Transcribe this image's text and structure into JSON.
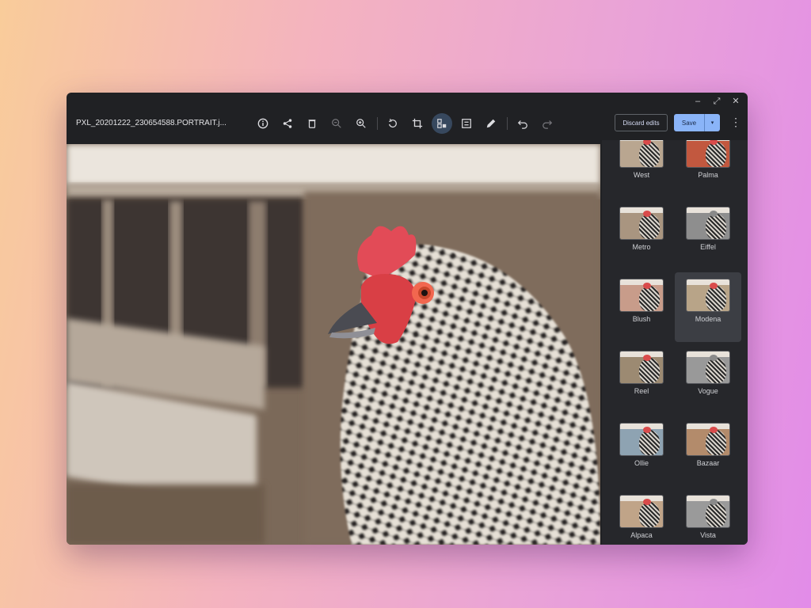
{
  "window": {
    "controls": {
      "minimize": "–",
      "restore": "⤢",
      "close": "✕"
    }
  },
  "toolbar": {
    "filename": "PXL_20201222_230654588.PORTRAIT.j...",
    "tools": [
      {
        "name": "info-icon",
        "glyph": "info"
      },
      {
        "name": "share-icon",
        "glyph": "share"
      },
      {
        "name": "delete-icon",
        "glyph": "trash"
      },
      {
        "name": "zoom-out-icon",
        "glyph": "zoom-out"
      },
      {
        "name": "zoom-in-icon",
        "glyph": "zoom-in"
      },
      {
        "name": "rotate-icon",
        "glyph": "rotate"
      },
      {
        "name": "crop-icon",
        "glyph": "crop"
      },
      {
        "name": "filters-icon",
        "glyph": "filters",
        "active": true
      },
      {
        "name": "adjust-icon",
        "glyph": "adjust"
      },
      {
        "name": "annotate-icon",
        "glyph": "annotate"
      },
      {
        "name": "undo-icon",
        "glyph": "undo"
      },
      {
        "name": "redo-icon",
        "glyph": "redo"
      }
    ],
    "discard_label": "Discard edits",
    "save_label": "Save",
    "save_dropdown_glyph": "▾",
    "more_glyph": "⋮"
  },
  "colors": {
    "accent": "#8ab4f8",
    "window_bg": "#202124",
    "panel_bg": "#26272b"
  },
  "filters": {
    "selected": "Modena",
    "items": [
      {
        "label": "West",
        "tone": "#b9a690"
      },
      {
        "label": "Palma",
        "tone": "#c2583f"
      },
      {
        "label": "Metro",
        "tone": "#a99580"
      },
      {
        "label": "Eiffel",
        "tone": "#8e8e8e"
      },
      {
        "label": "Blush",
        "tone": "#c89c8a"
      },
      {
        "label": "Modena",
        "tone": "#b8a488"
      },
      {
        "label": "Reel",
        "tone": "#9c8a72"
      },
      {
        "label": "Vogue",
        "tone": "#999999"
      },
      {
        "label": "Ollie",
        "tone": "#8ea3b2"
      },
      {
        "label": "Bazaar",
        "tone": "#b38b6b"
      },
      {
        "label": "Alpaca",
        "tone": "#c0a488"
      },
      {
        "label": "Vista",
        "tone": "#9a9a9a"
      }
    ]
  }
}
